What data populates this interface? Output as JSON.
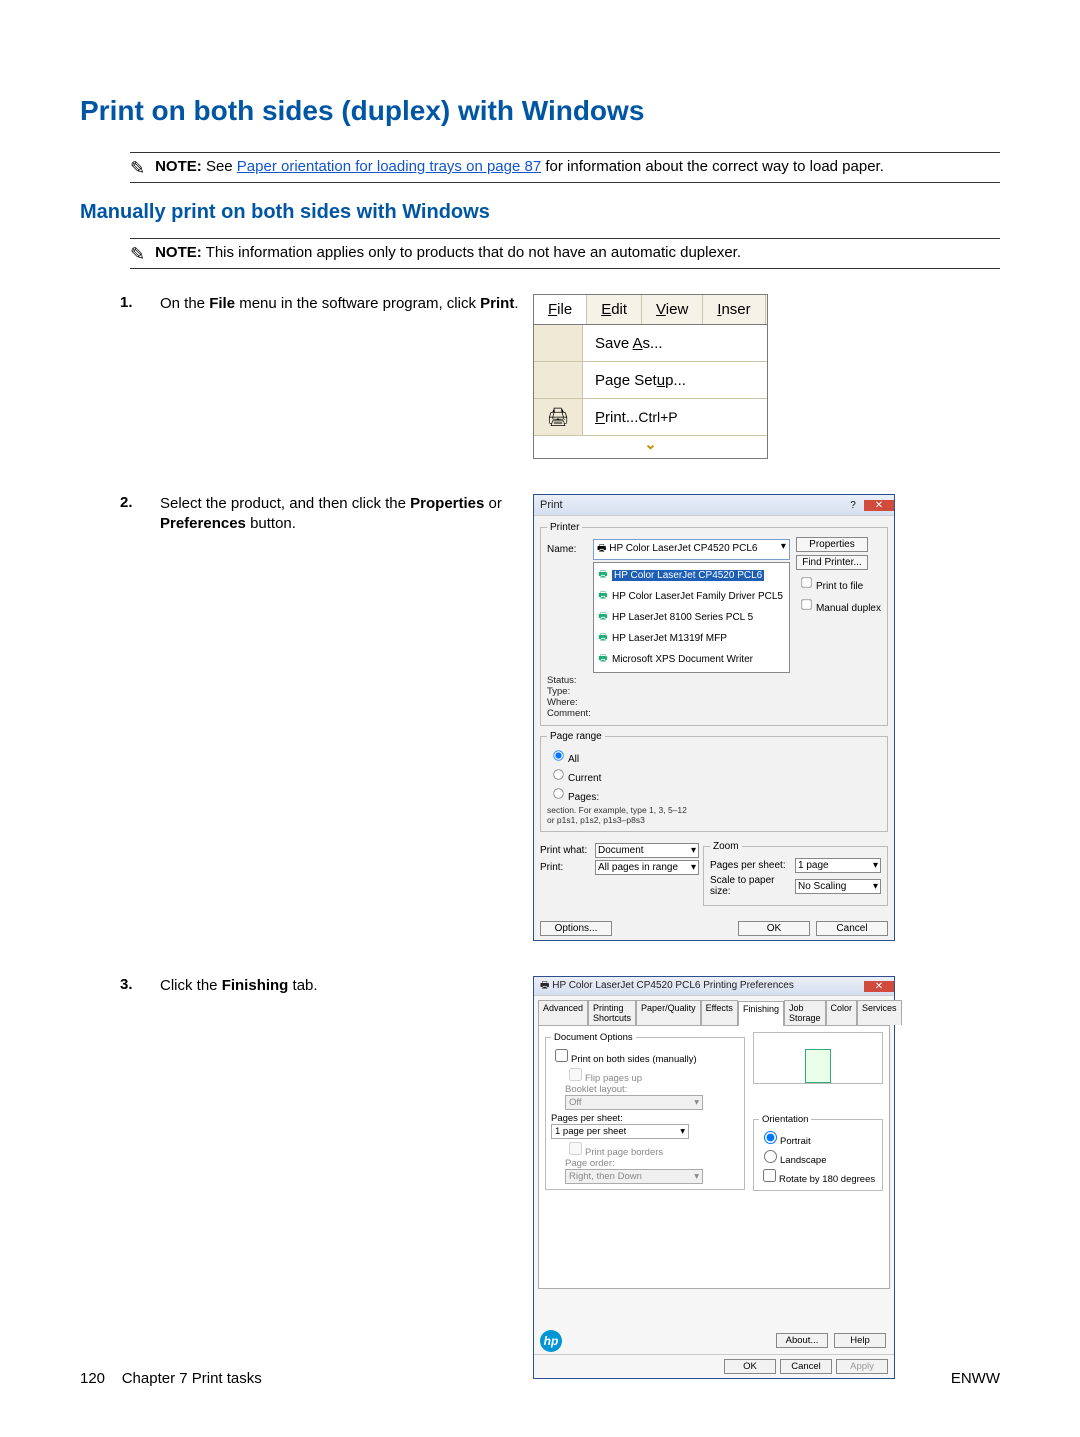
{
  "title": "Print on both sides (duplex) with Windows",
  "note1": {
    "label": "NOTE:",
    "pre": "See ",
    "link": "Paper orientation for loading trays on page 87",
    "post": " for information about the correct way to load paper."
  },
  "subtitle": "Manually print on both sides with Windows",
  "note2": {
    "label": "NOTE:",
    "text": "This information applies only to products that do not have an automatic duplexer."
  },
  "steps": {
    "s1": {
      "num": "1.",
      "pre": "On the ",
      "bold1": "File",
      "mid": " menu in the software program, click ",
      "bold2": "Print",
      "post": "."
    },
    "s2": {
      "num": "2.",
      "pre": "Select the product, and then click the ",
      "bold1": "Properties",
      "mid": " or ",
      "bold2": "Preferences",
      "post": " button."
    },
    "s3": {
      "num": "3.",
      "pre": "Click the ",
      "bold1": "Finishing",
      "post": " tab."
    }
  },
  "fig1": {
    "menus": {
      "file": "File",
      "edit": "Edit",
      "view": "View",
      "insert": "Inser"
    },
    "items": {
      "saveas": "Save As...",
      "pagesetup": "Page Setup...",
      "print": "Print...",
      "shortcut": "Ctrl+P"
    }
  },
  "fig2": {
    "title": "Print",
    "printer_legend": "Printer",
    "name_lbl": "Name:",
    "name_val": "HP Color LaserJet CP4520 PCL6",
    "status_lbl": "Status:",
    "type_lbl": "Type:",
    "where_lbl": "Where:",
    "comment_lbl": "Comment:",
    "drop_items": [
      "HP Color LaserJet CP4520 PCL6",
      "HP Color LaserJet Family Driver PCL5",
      "HP LaserJet 8100 Series PCL 5",
      "HP LaserJet M1319f MFP",
      "Microsoft XPS Document Writer"
    ],
    "btns": {
      "properties": "Properties",
      "find": "Find Printer...",
      "ptf": "Print to file",
      "manual": "Manual duplex"
    },
    "range_legend": "Page range",
    "range": {
      "all": "All",
      "current": "Current",
      "pages": "Pages:",
      "hint1": "Type page numbers and/or page ranges separated by commas counting from the start of the document or the section. For example, type 1, 3, 5–12 or p1s1, p1s2, p1s3–p8s3"
    },
    "printwhat_lbl": "Print what:",
    "printwhat_val": "Document",
    "print_lbl": "Print:",
    "print_val": "All pages in range",
    "zoom_legend": "Zoom",
    "pps_lbl": "Pages per sheet:",
    "pps_val": "1 page",
    "scale_lbl": "Scale to paper size:",
    "scale_val": "No Scaling",
    "options": "Options...",
    "ok": "OK",
    "cancel": "Cancel"
  },
  "fig3": {
    "title": "HP Color LaserJet CP4520 PCL6 Printing Preferences",
    "tabs": [
      "Advanced",
      "Printing Shortcuts",
      "Paper/Quality",
      "Effects",
      "Finishing",
      "Job Storage",
      "Color",
      "Services"
    ],
    "docopts_legend": "Document Options",
    "pbs": "Print on both sides (manually)",
    "flip": "Flip pages up",
    "booklet_lbl": "Booklet layout:",
    "booklet_val": "Off",
    "pps_lbl": "Pages per sheet:",
    "pps_val": "1 page per sheet",
    "ppb": "Print page borders",
    "pageorder_lbl": "Page order:",
    "pageorder_val": "Right, then Down",
    "orient_legend": "Orientation",
    "portrait": "Portrait",
    "landscape": "Landscape",
    "rotate": "Rotate by 180 degrees",
    "about": "About...",
    "help": "Help",
    "ok": "OK",
    "cancel": "Cancel",
    "apply": "Apply"
  },
  "footer": {
    "left_page": "120",
    "left_text": "Chapter 7   Print tasks",
    "right": "ENWW"
  }
}
